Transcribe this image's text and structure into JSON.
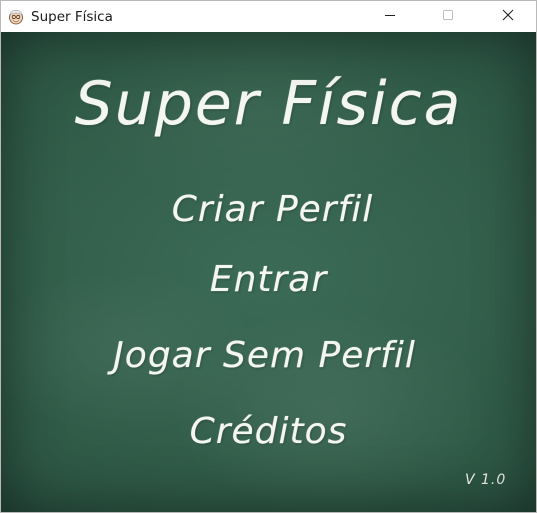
{
  "window": {
    "title": "Super Física",
    "controls": {
      "minimize": "minimize-icon",
      "maximize": "maximize-icon",
      "close": "close-icon"
    }
  },
  "screen": {
    "game_title": "Super Física",
    "menu": [
      {
        "id": "criar-perfil",
        "label": "Criar Perfil"
      },
      {
        "id": "entrar",
        "label": "Entrar"
      },
      {
        "id": "jogar-sem-perfil",
        "label": "Jogar Sem Perfil"
      },
      {
        "id": "creditos",
        "label": "Créditos"
      }
    ],
    "version": "V 1.0"
  },
  "colors": {
    "board": "#2f5a47",
    "chalk": "#f4f6f2",
    "titlebar": "#ffffff"
  },
  "icons": {
    "app": "scientist-avatar-icon"
  }
}
